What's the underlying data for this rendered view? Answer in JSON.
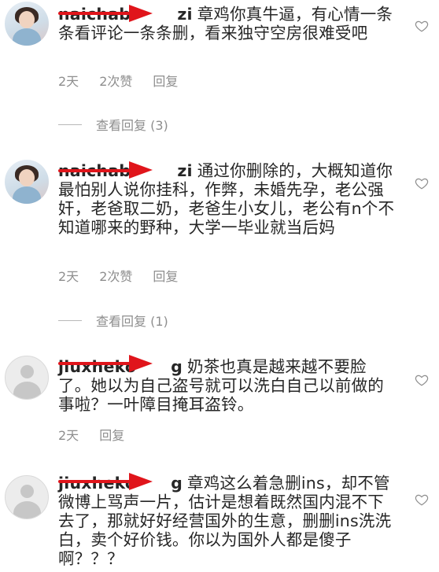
{
  "comments": [
    {
      "username": "naichabi",
      "username_tail": "zi",
      "text": "章鸡你真牛逼，有心情一条条看评论一条条删，看来独守空房很难受吧",
      "time": "2天",
      "likes": "2次赞",
      "reply_label": "回复",
      "view_replies": "查看回复 (3)",
      "avatar": "user-photo-avatar"
    },
    {
      "username": "naichabi",
      "username_tail": "zi",
      "text": "通过你删除的，大概知道你最怕别人说你挂科，作弊，未婚先孕，老公强奸，老爸取二奶，老爸生小女儿，老公有n个不知道哪来的野种，大学一毕业就当后妈",
      "time": "2天",
      "likes": "2次赞",
      "reply_label": "回复",
      "view_replies": "查看回复 (1)",
      "avatar": "user-photo-avatar"
    },
    {
      "username": "jiuxheko",
      "username_tail": "g",
      "text": "奶茶也真是越来越不要脸了。她以为自己盗号就可以洗白自己以前做的事啦？一叶障目掩耳盗铃。",
      "time": "2天",
      "reply_label": "回复",
      "avatar": "default-avatar"
    },
    {
      "username": "jiuxheko",
      "username_tail": "g",
      "text": "章鸡这么着急删ins，却不管微博上骂声一片，估计是想着既然国内混不下去了，那就好好经营国外的生意，删删ins洗洗白，卖个好价钱。你以为国外人都是傻子啊？？？",
      "avatar": "default-avatar"
    }
  ],
  "icons": {
    "like": "heart-outline-icon",
    "redact_color": "#e0151b"
  }
}
